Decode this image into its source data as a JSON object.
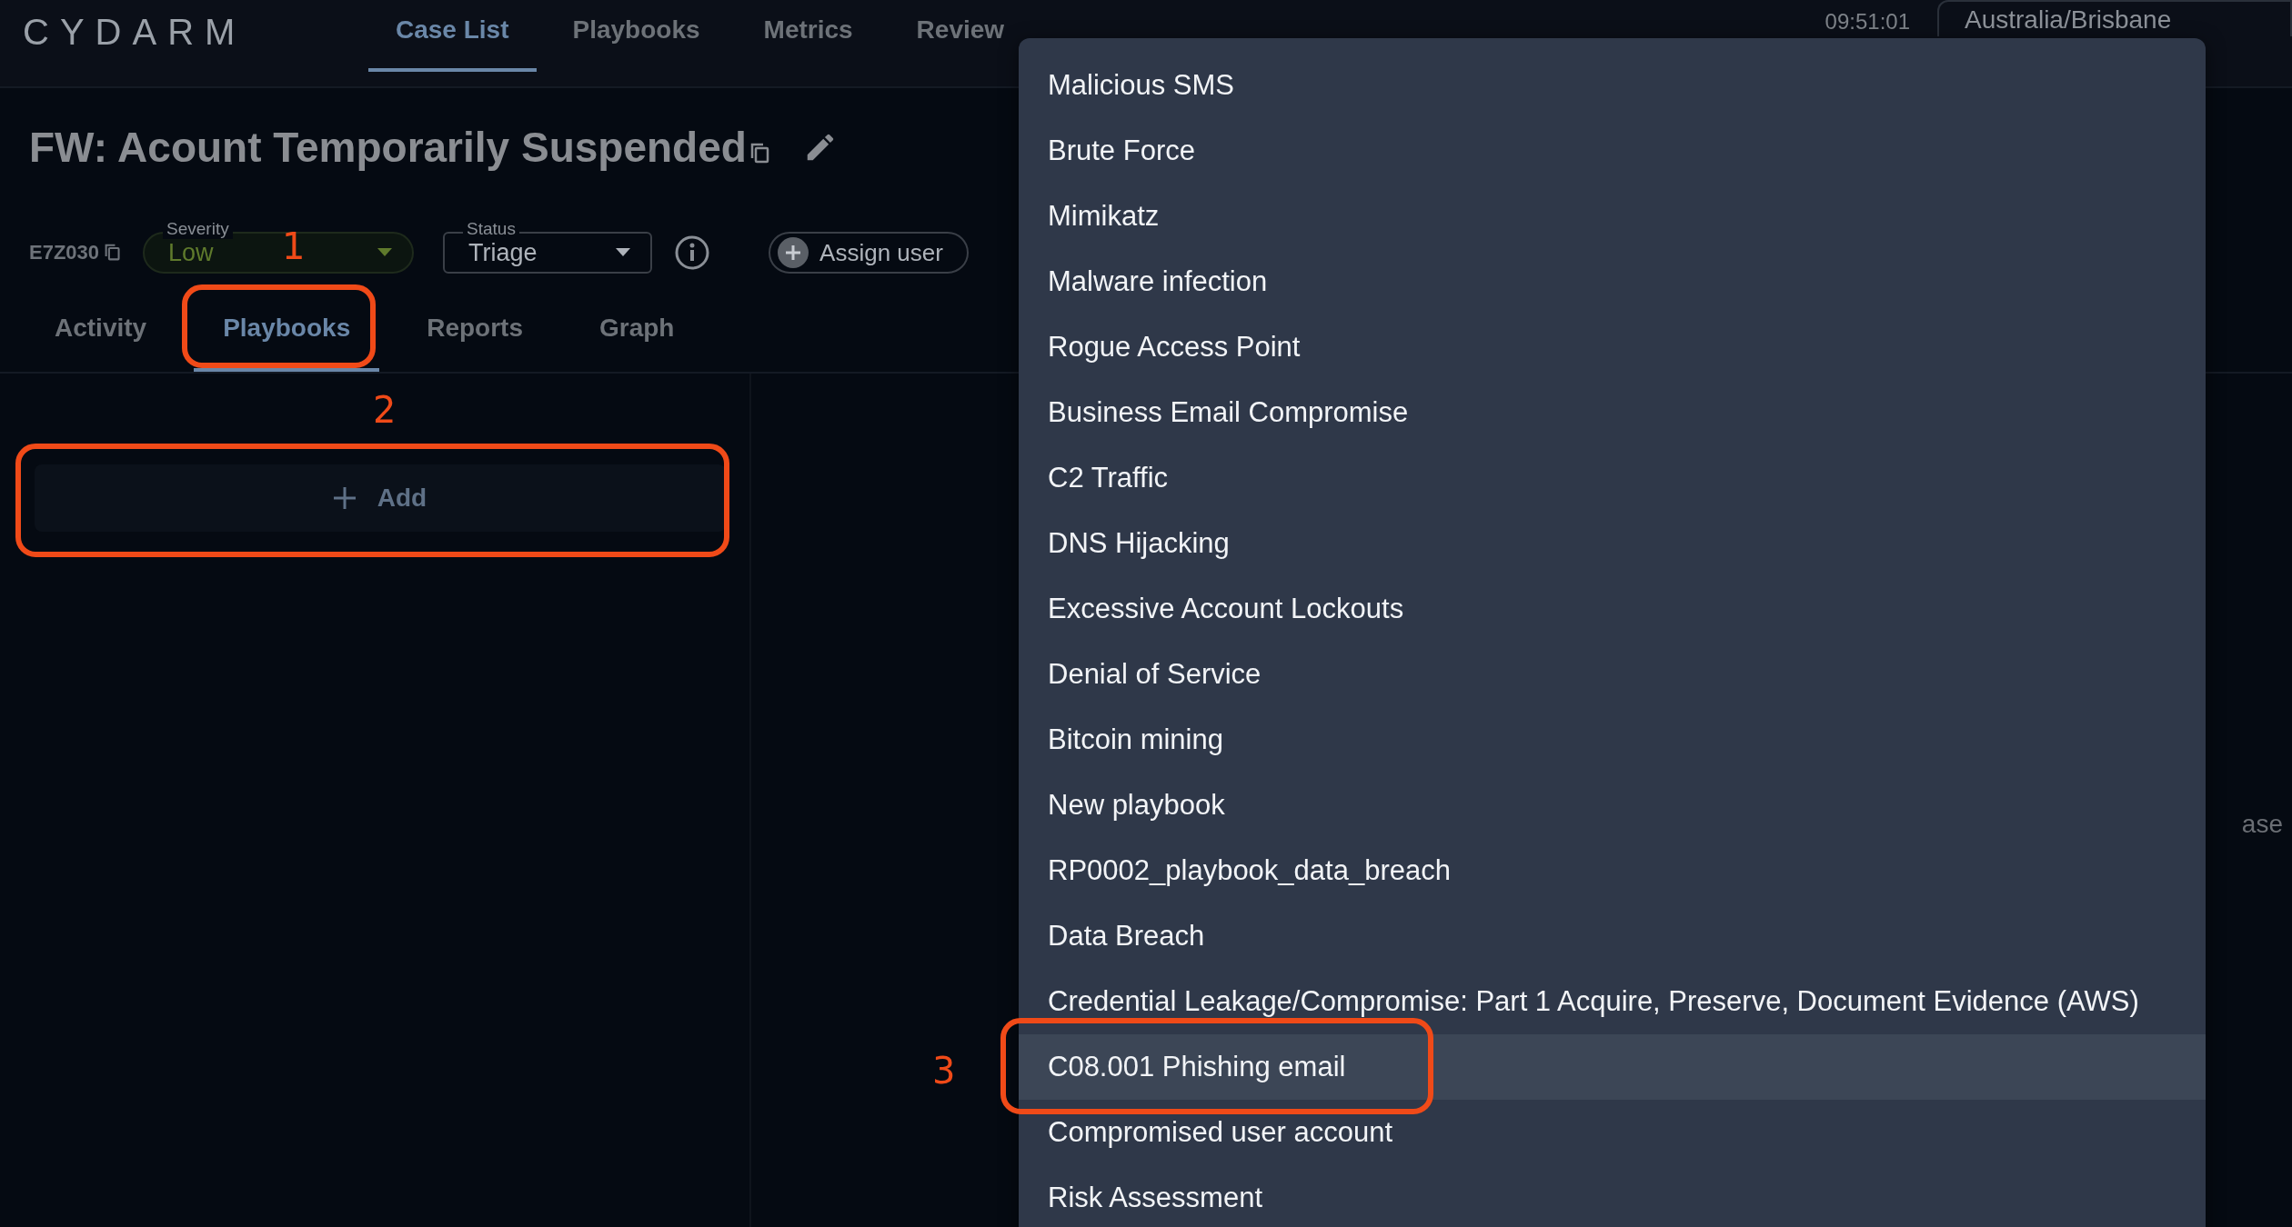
{
  "header": {
    "logo": "CYDARM",
    "nav": [
      {
        "label": "Case List",
        "selected": true
      },
      {
        "label": "Playbooks",
        "selected": false
      },
      {
        "label": "Metrics",
        "selected": false
      },
      {
        "label": "Review",
        "selected": false
      }
    ],
    "clock": "09:51:01",
    "timezone": "Australia/Brisbane"
  },
  "case": {
    "title": "FW: Acount Temporarily Suspended",
    "id": "E7Z030",
    "severity": {
      "label": "Severity",
      "value": "Low"
    },
    "status": {
      "label": "Status",
      "value": "Triage"
    },
    "assign_button": "Assign user"
  },
  "tabs": [
    {
      "label": "Activity",
      "selected": false
    },
    {
      "label": "Playbooks",
      "selected": true
    },
    {
      "label": "Reports",
      "selected": false
    },
    {
      "label": "Graph",
      "selected": false
    }
  ],
  "playbooks_panel": {
    "add_button": "Add"
  },
  "detail_panel": {
    "text": "ase"
  },
  "playbook_menu": {
    "items": [
      {
        "label": "Malicious SMS",
        "selected": false
      },
      {
        "label": "Brute Force",
        "selected": false
      },
      {
        "label": "Mimikatz",
        "selected": false
      },
      {
        "label": "Malware infection",
        "selected": false
      },
      {
        "label": "Rogue Access Point",
        "selected": false
      },
      {
        "label": "Business Email Compromise",
        "selected": false
      },
      {
        "label": "C2 Traffic",
        "selected": false
      },
      {
        "label": "DNS Hijacking",
        "selected": false
      },
      {
        "label": "Excessive Account Lockouts",
        "selected": false
      },
      {
        "label": "Denial of Service",
        "selected": false
      },
      {
        "label": "Bitcoin mining",
        "selected": false
      },
      {
        "label": "New playbook",
        "selected": false
      },
      {
        "label": "RP0002_playbook_data_breach",
        "selected": false
      },
      {
        "label": "Data Breach",
        "selected": false
      },
      {
        "label": "Credential Leakage/Compromise: Part 1 Acquire, Preserve, Document Evidence (AWS)",
        "selected": false
      },
      {
        "label": "C08.001 Phishing email",
        "selected": true
      },
      {
        "label": "Compromised user account",
        "selected": false
      },
      {
        "label": "Risk Assessment",
        "selected": false
      }
    ]
  },
  "annotations": [
    {
      "label": "1"
    },
    {
      "label": "2"
    },
    {
      "label": "3"
    }
  ]
}
